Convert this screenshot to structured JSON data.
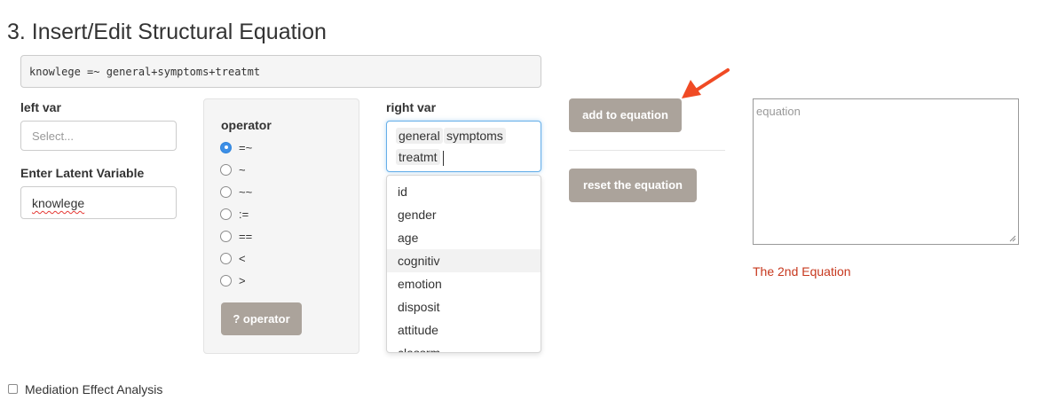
{
  "heading": "3. Insert/Edit Structural Equation",
  "equation_preview": "knowlege =~ general+symptoms+treatmt",
  "left_var": {
    "label": "left var",
    "placeholder": "Select..."
  },
  "latent": {
    "label": "Enter Latent Variable",
    "value": "knowlege"
  },
  "operator": {
    "label": "operator",
    "options": [
      "=~",
      "~",
      "~~",
      ":=",
      "==",
      "<",
      ">"
    ],
    "selected": "=~",
    "help_button": "? operator"
  },
  "right_var": {
    "label": "right var",
    "selected_tags": [
      "general",
      "symptoms",
      "treatmt"
    ],
    "dropdown_options": [
      "id",
      "gender",
      "age",
      "cognitiv",
      "emotion",
      "disposit",
      "attitude",
      "classrm"
    ],
    "highlighted": "cognitiv"
  },
  "buttons": {
    "add": "add to equation",
    "reset": "reset the equation"
  },
  "equation_area": {
    "placeholder": "equation"
  },
  "status_text": "The 2nd Equation",
  "mediation": {
    "label": "Mediation Effect Analysis",
    "checked": false
  },
  "colors": {
    "button": "#aba39b",
    "accent": "#3d8fe6",
    "status": "#c7381e",
    "arrow": "#f04a24"
  }
}
